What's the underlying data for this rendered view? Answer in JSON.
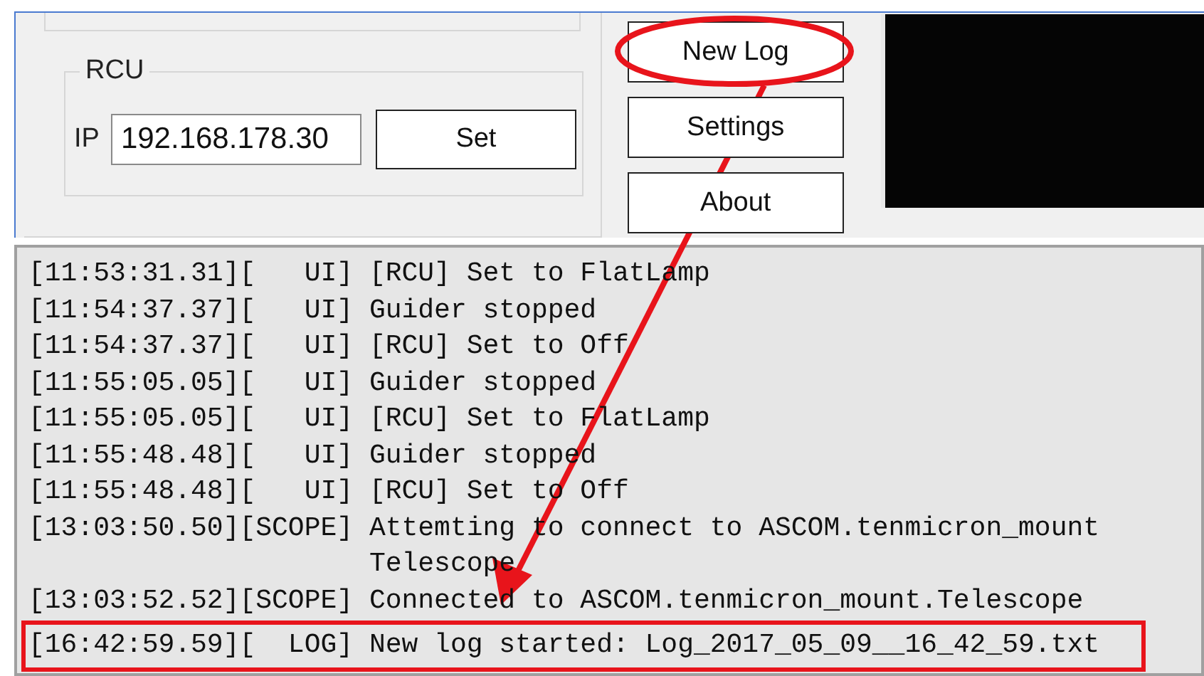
{
  "rcu": {
    "title": "RCU",
    "ip_label": "IP",
    "ip_value": "192.168.178.30",
    "set_button": "Set"
  },
  "buttons": [
    {
      "label": "New Log",
      "circled": true
    },
    {
      "label": "Settings",
      "circled": false
    },
    {
      "label": "About",
      "circled": false
    }
  ],
  "log": [
    {
      "lines": [
        "[11:53:31.31][   UI] [RCU] Set to FlatLamp"
      ],
      "highlighted": false
    },
    {
      "lines": [
        "[11:54:37.37][   UI] Guider stopped"
      ],
      "highlighted": false
    },
    {
      "lines": [
        "[11:54:37.37][   UI] [RCU] Set to Off"
      ],
      "highlighted": false
    },
    {
      "lines": [
        "[11:55:05.05][   UI] Guider stopped"
      ],
      "highlighted": false
    },
    {
      "lines": [
        "[11:55:05.05][   UI] [RCU] Set to FlatLamp"
      ],
      "highlighted": false
    },
    {
      "lines": [
        "[11:55:48.48][   UI] Guider stopped"
      ],
      "highlighted": false
    },
    {
      "lines": [
        "[11:55:48.48][   UI] [RCU] Set to Off"
      ],
      "highlighted": false
    },
    {
      "lines": [
        "[13:03:50.50][SCOPE] Attemting to connect to ASCOM.tenmicron_mount",
        "Telescope"
      ],
      "highlighted": false
    },
    {
      "lines": [
        "[13:03:52.52][SCOPE] Connected to ASCOM.tenmicron_mount.Telescope"
      ],
      "highlighted": false
    },
    {
      "lines": [
        "[16:42:59.59][  LOG] New log started: Log_2017_05_09__16_42_59.txt"
      ],
      "highlighted": true
    }
  ]
}
